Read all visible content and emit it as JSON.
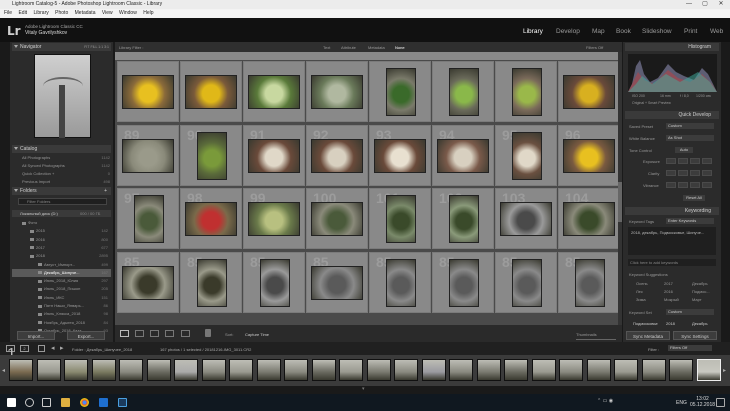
{
  "window": {
    "title": "Lightroom Catalog-5 - Adobe Photoshop Lightroom Classic - Library",
    "minimize": "—",
    "maximize": "▢",
    "close": "✕"
  },
  "menu": [
    "File",
    "Edit",
    "Library",
    "Photo",
    "Metadata",
    "View",
    "Window",
    "Help"
  ],
  "identity": {
    "logo": "Lr",
    "line1": "Adobe Lightroom Classic CC",
    "line2": "Vitaly Gavrilyshkov"
  },
  "modules": [
    "Library",
    "Develop",
    "Map",
    "Book",
    "Slideshow",
    "Print",
    "Web"
  ],
  "navigator": {
    "title": "Navigator",
    "zoom": "FIT  FILL  1:1  3:1"
  },
  "catalog": {
    "title": "Catalog",
    "items": [
      {
        "label": "All Photographs",
        "count": "1142"
      },
      {
        "label": "All Synced Photographs",
        "count": "1142"
      },
      {
        "label": "Quick Collection +",
        "count": "0"
      },
      {
        "label": "Previous Import",
        "count": "498"
      }
    ]
  },
  "folders": {
    "title": "Folders",
    "filter_placeholder": "Filter Folders",
    "volume": {
      "label": "Локальный диск (D:)",
      "info": "000 / 00 ГБ"
    },
    "items": [
      {
        "label": "Фото",
        "count": ""
      },
      {
        "label": "2015",
        "count": "142"
      },
      {
        "label": "2016",
        "count": "800"
      },
      {
        "label": "2017",
        "count": "677"
      },
      {
        "label": "2018",
        "count": "2895"
      },
      {
        "label": "Август_Импорт...",
        "count": "499"
      },
      {
        "label": "Декабрь_Шипуче...",
        "count": "167"
      },
      {
        "label": "Июнь_2018_Юлия",
        "count": "297"
      },
      {
        "label": "Июль_2018_Пишон",
        "count": "205"
      },
      {
        "label": "Июнь_ИКС",
        "count": "151"
      },
      {
        "label": "Пятн Наши_Январь...",
        "count": "86"
      },
      {
        "label": "Июль_Клякса_2018",
        "count": "98"
      },
      {
        "label": "Ноябрь_Адыгея_2018",
        "count": "84"
      },
      {
        "label": "Октябрь_2018_Каза...",
        "count": "93"
      }
    ]
  },
  "left_buttons": {
    "import": "Import...",
    "export": "Export..."
  },
  "library_filter": {
    "title": "Library Filter :",
    "tabs": [
      "Text",
      "Attribute",
      "Metadata",
      "None"
    ],
    "status": "Filters Off"
  },
  "grid": {
    "row_numbers": [
      "85",
      "86",
      "87",
      "88",
      "89",
      "90",
      "91",
      "92",
      "93",
      "94",
      "95",
      "96",
      "97",
      "98",
      "99",
      "100",
      "101",
      "102",
      "103",
      "104"
    ]
  },
  "toolbar": {
    "sort_label": "Sort:",
    "sort_value": "Capture Time",
    "thumbnails_label": "Thumbnails"
  },
  "histogram": {
    "title": "Histogram",
    "info_left": "ISO 200",
    "info_mid": "16 mm",
    "info_f": "f / 8,0",
    "info_s": "1/200 сек",
    "original": "Original + Smart Preview"
  },
  "quick_develop": {
    "title": "Quick Develop",
    "saved_preset_label": "Saved Preset",
    "saved_preset_value": "Custom",
    "wb_label": "White Balance",
    "wb_value": "As Shot",
    "tone_label": "Tone Control",
    "tone_value": "Auto",
    "rows": [
      "Exposure",
      "Clarity",
      "Vibrance"
    ],
    "reset": "Reset All"
  },
  "keywording": {
    "title": "Keywording",
    "tags_label": "Keyword Tags",
    "tags_value": "Enter Keywords",
    "tags_text": "2018, декабрь, Подмосковье, Шипуче...",
    "click_hint": "Click here to add keywords",
    "suggestions_title": "Keyword Suggestions",
    "suggestions": [
      "Осень",
      "2017",
      "Декабрь",
      "Лес",
      "2016",
      "Подмос...",
      "Зима",
      "Мокрый",
      "Март"
    ],
    "set_label": "Keyword Set",
    "set_value": "Custom",
    "set_items": [
      "Подмосковье",
      "2018",
      "Декабрь"
    ],
    "sync_meta": "Sync Metadata",
    "sync_settings": "Sync Settings"
  },
  "filmstrip": {
    "pages": [
      "1",
      "2"
    ],
    "source": "Folder : Декабрь_Шипучее_2018",
    "status": "167 photos / 1 selected / 20181216-IMG_3011.CR2",
    "filter_label": "Filter :",
    "filter_value": "Filters Off"
  },
  "taskbar": {
    "lang": "ENG",
    "time": "13:02",
    "date": "05.12.2018"
  },
  "colors": {
    "accent": "#ffffff",
    "panel": "#2b2b2b",
    "grid_bg": "#4a4a4a",
    "cell": "#898989"
  }
}
